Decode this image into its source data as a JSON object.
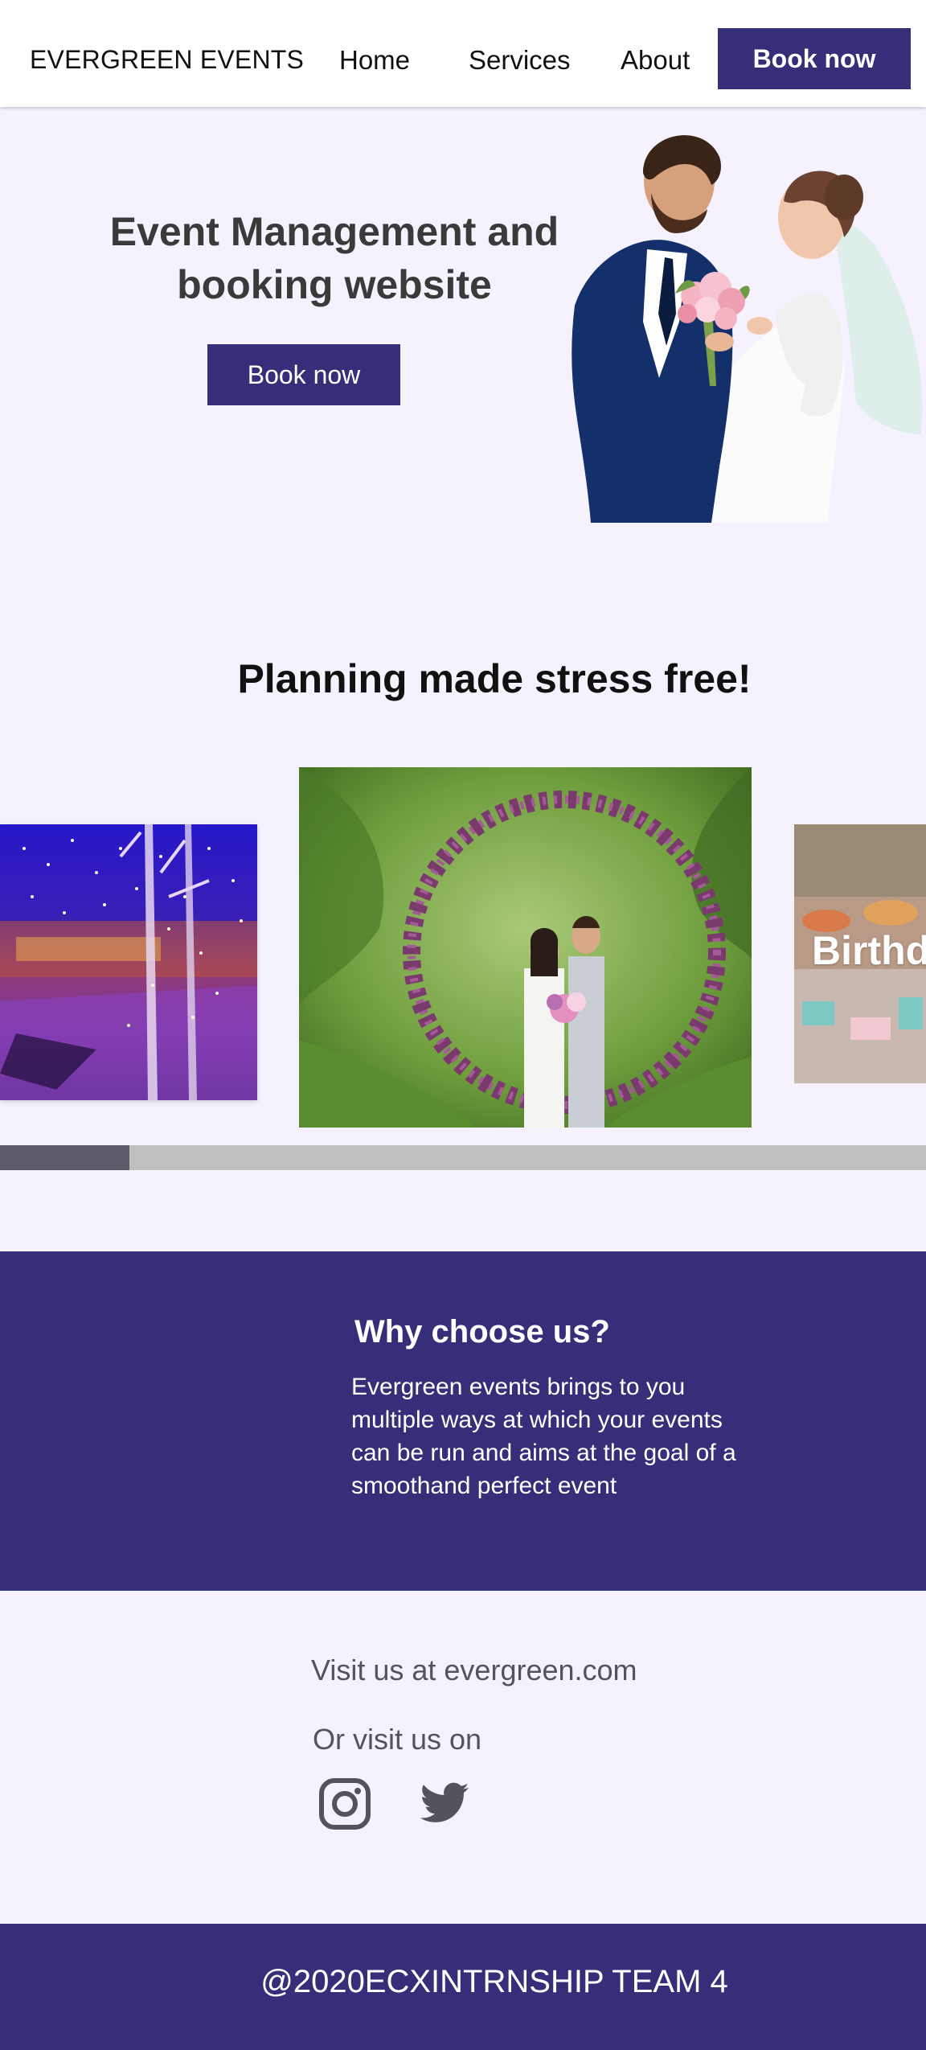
{
  "nav": {
    "brand": "EVERGREEN EVENTS",
    "links": [
      "Home",
      "Services",
      "About"
    ],
    "cta": "Book now"
  },
  "hero": {
    "title": "Event Management and booking website",
    "cta": "Book now",
    "image_icon": "wedding-couple-photo"
  },
  "planning": {
    "title": "Planning made stress free!",
    "slides": [
      {
        "name": "lights-venue-photo",
        "label": ""
      },
      {
        "name": "wedding-arch-photo",
        "label": ""
      },
      {
        "name": "birthday-photo",
        "label": "Birthd"
      }
    ],
    "scroll_progress": 0.14
  },
  "why": {
    "title": "Why choose us?",
    "text": "Evergreen events brings to you multiple ways at which your events can be run and aims at the goal of a smoothand perfect event"
  },
  "visit": {
    "line": "Visit us at evergreen.com",
    "or": "Or visit us on",
    "social": [
      "instagram-icon",
      "twitter-icon"
    ]
  },
  "footer": {
    "text": "@2020ECXINTRNSHIP TEAM 4"
  },
  "colors": {
    "brand": "#352e78",
    "background": "#f5f2fd",
    "scroll_track": "#c0c0c0",
    "scroll_thumb": "#5d5a69"
  }
}
